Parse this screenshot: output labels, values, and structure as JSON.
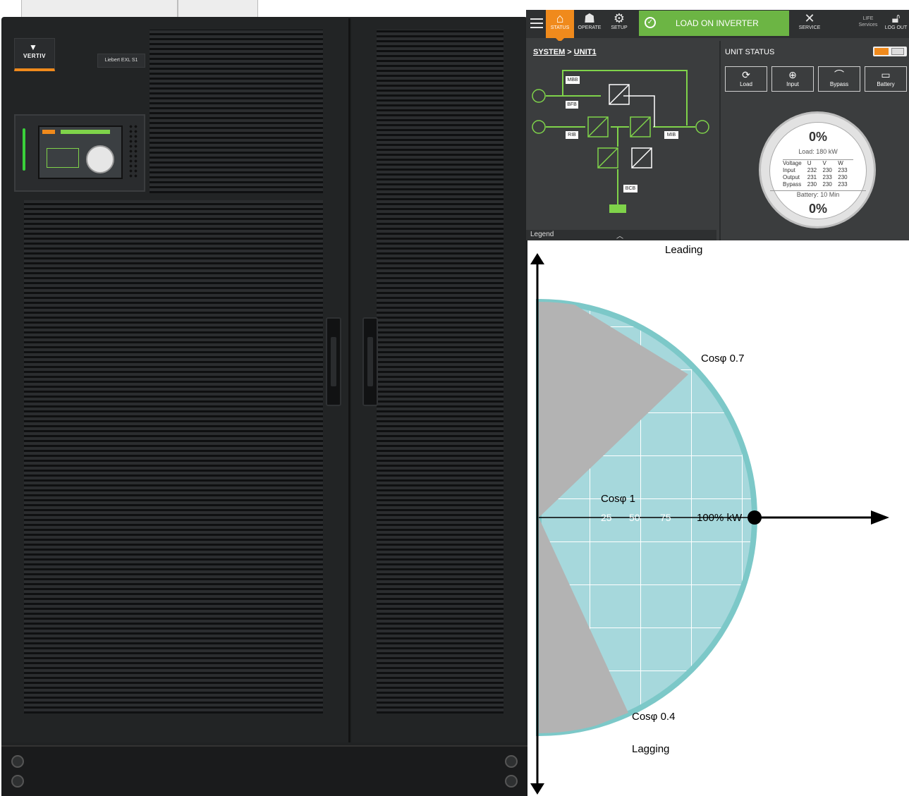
{
  "cabinet": {
    "brand": "VERTIV",
    "model": "Liebert EXL S1"
  },
  "hmi": {
    "nav": [
      {
        "label": "STATUS",
        "icon": "home-icon"
      },
      {
        "label": "OPERATE",
        "icon": "operator-icon"
      },
      {
        "label": "SETUP",
        "icon": "gear-icon"
      },
      {
        "label": "SERVICE",
        "icon": "tools-icon"
      },
      {
        "label": "LOG OUT",
        "icon": "lock-icon"
      }
    ],
    "status_message": "LOAD ON INVERTER",
    "life_services_line1": "LIFE",
    "life_services_line2": "Services",
    "breadcrumb": {
      "system": "SYSTEM",
      "separator": ">",
      "unit": "UNIT1"
    },
    "diagram_labels": {
      "mbb": "MBB",
      "bfb": "BFB",
      "rib": "RIB",
      "mib": "MIB",
      "bcb": "BCB"
    },
    "legend_label": "Legend",
    "unit_status_title": "UNIT STATUS",
    "unit_buttons": [
      {
        "label": "Load",
        "icon": "load-icon"
      },
      {
        "label": "Input",
        "icon": "input-icon"
      },
      {
        "label": "Bypass",
        "icon": "bypass-icon"
      },
      {
        "label": "Battery",
        "icon": "battery-icon"
      }
    ],
    "gauge": {
      "top_percent": "0%",
      "load_text": "Load: 180 kW",
      "table_headers": [
        "Voltage",
        "U",
        "V",
        "W"
      ],
      "table_rows": [
        [
          "Input",
          "232",
          "230",
          "233"
        ],
        [
          "Output",
          "231",
          "233",
          "230"
        ],
        [
          "Bypass",
          "230",
          "230",
          "233"
        ]
      ],
      "battery_text": "Battery: 10 Min",
      "bottom_percent": "0%"
    },
    "colors": {
      "accent": "#f08a1c",
      "ok": "#6cb544",
      "line": "#7fd34a"
    }
  },
  "pf_diagram": {
    "leading": "Leading",
    "lagging": "Lagging",
    "cos07": "Cosφ 0.7",
    "cos1": "Cosφ 1",
    "cos04": "Cosφ 0.4",
    "ticks": [
      "25",
      "50",
      "75"
    ],
    "max_label": "100% kW",
    "colors": {
      "capability": "#a6d8dc",
      "outline": "#7cc8c8",
      "gray": "#b3b3b3"
    }
  }
}
